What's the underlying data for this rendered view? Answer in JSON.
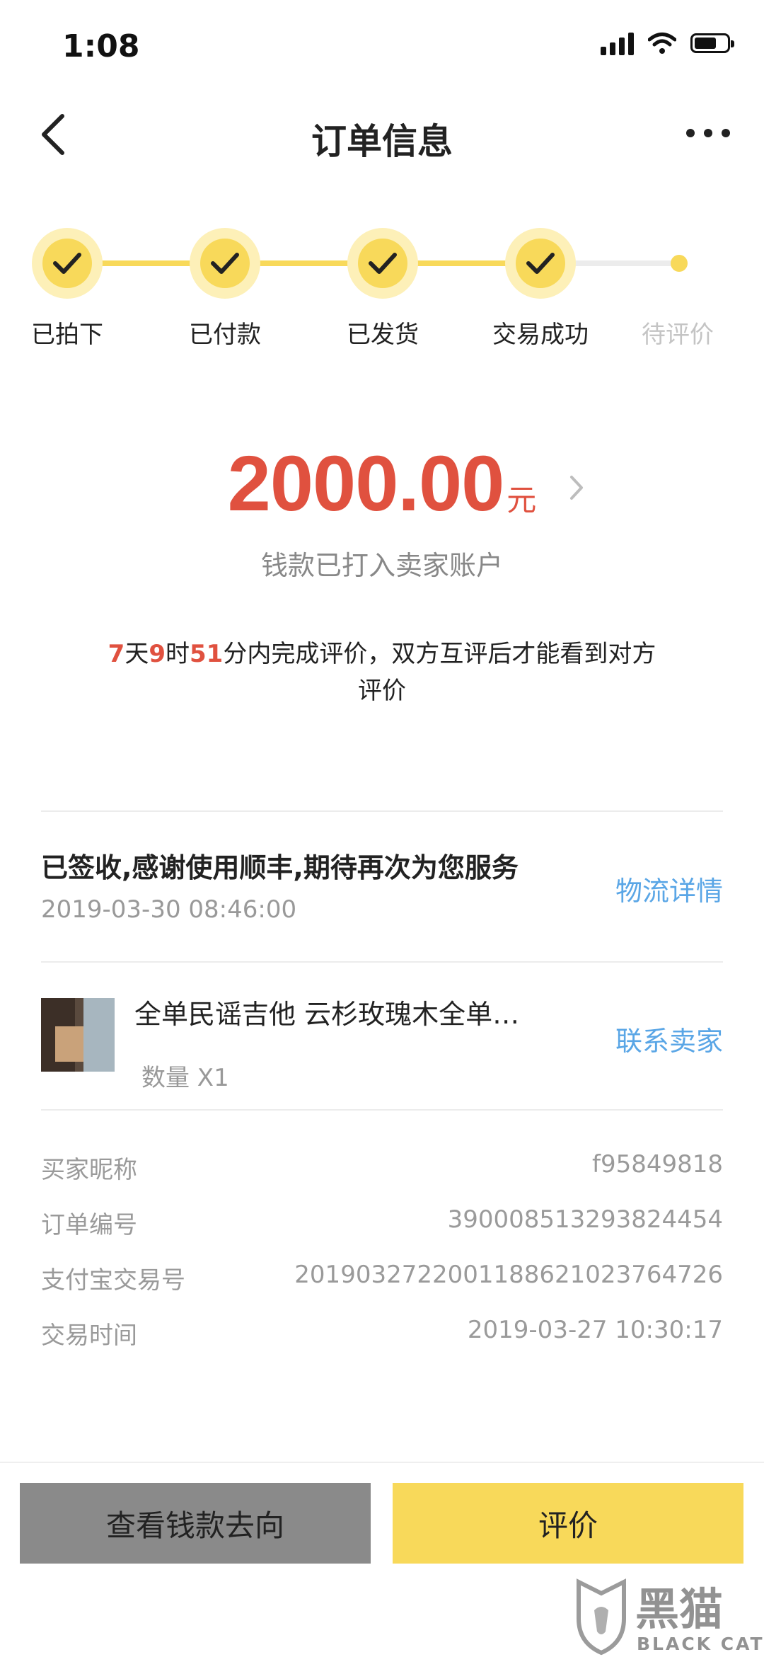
{
  "status_bar": {
    "time": "1:08"
  },
  "nav": {
    "title": "订单信息"
  },
  "steps": [
    {
      "label": "已拍下",
      "done": true
    },
    {
      "label": "已付款",
      "done": true
    },
    {
      "label": "已发货",
      "done": true
    },
    {
      "label": "交易成功",
      "done": true
    },
    {
      "label": "待评价",
      "done": false
    }
  ],
  "amount": {
    "value": "2000.00",
    "unit": "元",
    "subtitle": "钱款已打入卖家账户"
  },
  "review_note": {
    "days": "7",
    "days_unit": "天",
    "hours": "9",
    "hours_unit": "时",
    "minutes": "51",
    "text": "分内完成评价，双方互评后才能看到对方评价"
  },
  "logistics": {
    "status": "已签收,感谢使用顺丰,期待再次为您服务",
    "time": "2019-03-30 08:46:00",
    "link": "物流详情"
  },
  "product": {
    "title": "全单民谣吉他 云杉玫瑰木全单…",
    "quantity": "数量 X1",
    "contact": "联系卖家"
  },
  "info": [
    {
      "key": "买家昵称",
      "value": "f95849818"
    },
    {
      "key": "订单编号",
      "value": "390008513293824454"
    },
    {
      "key": "支付宝交易号",
      "value": "2019032722001188621023764726"
    },
    {
      "key": "交易时间",
      "value": "2019-03-27 10:30:17"
    }
  ],
  "buttons": {
    "money_flow": "查看钱款去向",
    "review": "评价"
  },
  "watermark": {
    "text_cn": "黑猫",
    "text_en": "BLACK CAT"
  },
  "colors": {
    "accent_yellow": "#f8d95a",
    "price_red": "#e0513f",
    "link_blue": "#5aa6e6"
  }
}
